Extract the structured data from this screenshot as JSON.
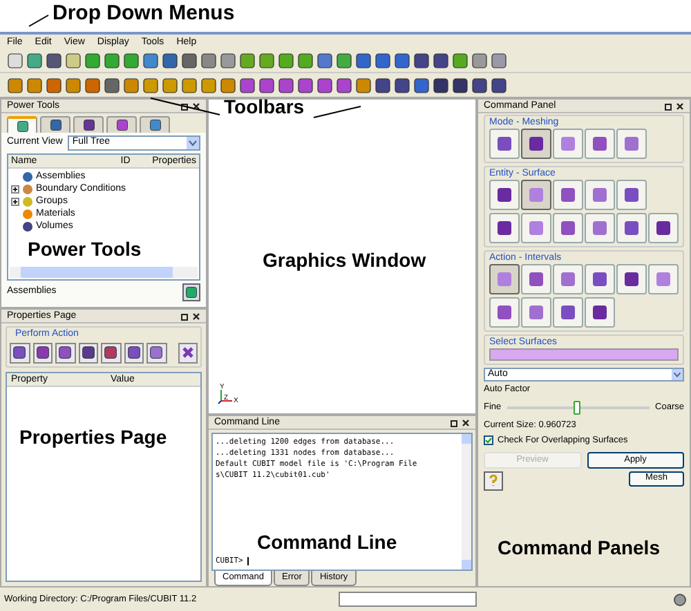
{
  "annotations": [
    {
      "kind": "menus",
      "text": "Drop Down Menus"
    },
    {
      "kind": "toolbars",
      "text": "Toolbars"
    },
    {
      "kind": "power",
      "text": "Power Tools"
    },
    {
      "kind": "graphics",
      "text": "Graphics Window"
    },
    {
      "kind": "properties",
      "text": "Properties Page"
    },
    {
      "kind": "command_line",
      "text": "Command Line"
    },
    {
      "kind": "panels",
      "text": "Command Panels"
    }
  ],
  "menu_bar": [
    "File",
    "Edit",
    "View",
    "Display",
    "Tools",
    "Help"
  ],
  "power_tools": {
    "title": "Power Tools",
    "tabs": [
      {
        "selected": true
      },
      {
        "selected": false
      },
      {
        "selected": false
      },
      {
        "selected": false
      },
      {
        "selected": false
      }
    ],
    "view_label": "Current View",
    "view_value": "Full Tree",
    "columns": [
      "Name",
      "ID",
      "Properties"
    ],
    "tree": [
      {
        "label": "Assemblies",
        "expandable": false
      },
      {
        "label": "Boundary Conditions",
        "expandable": true
      },
      {
        "label": "Groups",
        "expandable": true
      },
      {
        "label": "Materials",
        "expandable": false
      },
      {
        "label": "Volumes",
        "expandable": false
      }
    ],
    "footer": "Assemblies"
  },
  "properties_page": {
    "title": "Properties Page",
    "group": "Perform Action",
    "columns": [
      "Property",
      "Value"
    ]
  },
  "graphics_window": {
    "axes": [
      "Y",
      "Z",
      "X"
    ]
  },
  "command_line": {
    "title": "Command Line",
    "lines": [
      "...deleting 1200 edges from database...",
      "...deleting 1331 nodes from database...",
      "Default CUBIT model file is 'C:\\Program File",
      "s\\CUBIT 11.2\\cubit01.cub'"
    ],
    "prompt": "CUBIT>",
    "tabs": [
      {
        "label": "Command",
        "selected": true
      },
      {
        "label": "Error",
        "selected": false
      },
      {
        "label": "History",
        "selected": false
      }
    ]
  },
  "command_panel": {
    "title": "Command Panel",
    "groups": [
      {
        "title": "Mode - Meshing",
        "buttons": [
          {
            "selected": false
          },
          {
            "selected": true
          },
          {
            "selected": false
          },
          {
            "selected": false
          },
          {
            "selected": false
          }
        ]
      },
      {
        "title": "Entity - Surface",
        "buttons": [
          {
            "selected": false
          },
          {
            "selected": true
          },
          {
            "selected": false
          },
          {
            "selected": false
          },
          {
            "selected": false
          },
          {
            "selected": false
          },
          {
            "selected": false
          },
          {
            "selected": false
          },
          {
            "selected": false
          },
          {
            "selected": false
          },
          {
            "selected": false
          }
        ]
      },
      {
        "title": "Action - Intervals",
        "buttons": [
          {
            "selected": true
          },
          {
            "selected": false
          },
          {
            "selected": false
          },
          {
            "selected": false
          },
          {
            "selected": false
          },
          {
            "selected": false
          },
          {
            "selected": false
          },
          {
            "selected": false
          },
          {
            "selected": false
          },
          {
            "selected": false
          }
        ]
      }
    ],
    "select_label": "Select Surfaces",
    "scheme": "Auto",
    "factor_label": "Auto Factor",
    "slider": {
      "min_label": "Fine",
      "max_label": "Coarse",
      "level": 0.5
    },
    "current_size": "Current Size: 0.960723",
    "overlap": {
      "label": "Check For Overlapping Surfaces",
      "checked": true
    },
    "buttons": [
      {
        "label": "Preview",
        "disabled": true
      },
      {
        "label": "Apply",
        "disabled": false
      }
    ],
    "mesh_button": "Mesh"
  },
  "status_bar": {
    "text": "Working Directory: C:/Program Files/CUBIT 11.2"
  }
}
